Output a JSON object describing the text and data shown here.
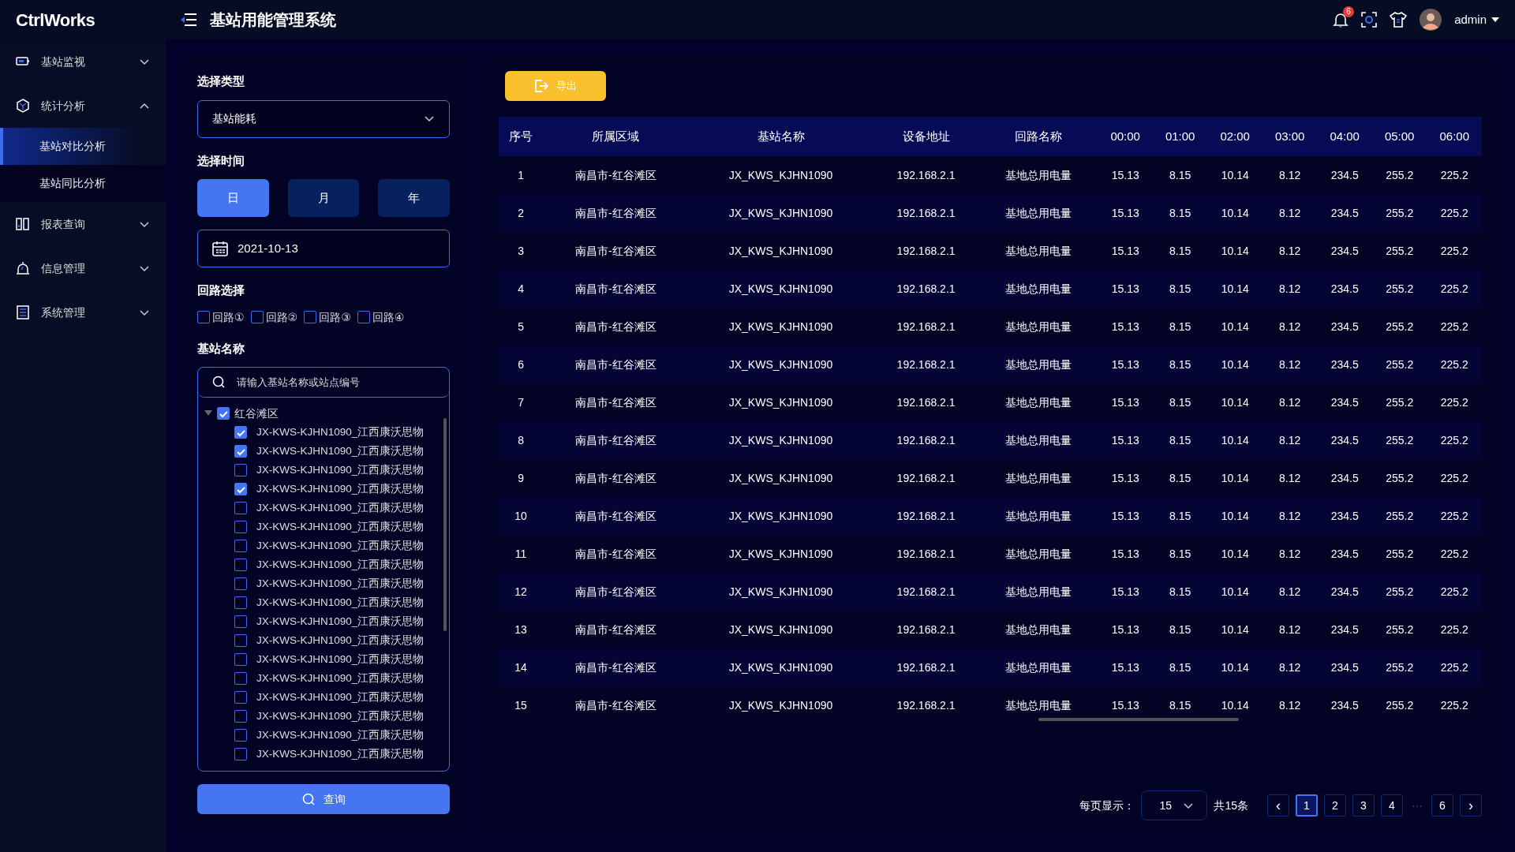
{
  "header": {
    "logo": "CtrlWorks",
    "title": "基站用能管理系统",
    "notification_count": "6",
    "user": "admin"
  },
  "sidebar": {
    "items": [
      {
        "label": "基站监视",
        "expanded": false
      },
      {
        "label": "统计分析",
        "expanded": true,
        "children": [
          {
            "label": "基站对比分析",
            "selected": true
          },
          {
            "label": "基站同比分析",
            "selected": false
          }
        ]
      },
      {
        "label": "报表查询",
        "expanded": false
      },
      {
        "label": "信息管理",
        "expanded": false
      },
      {
        "label": "系统管理",
        "expanded": false
      }
    ]
  },
  "filters": {
    "type_label": "选择类型",
    "type_value": "基站能耗",
    "time_label": "选择时间",
    "time_buttons": [
      {
        "label": "日",
        "selected": true
      },
      {
        "label": "月",
        "selected": false
      },
      {
        "label": "年",
        "selected": false
      }
    ],
    "date": "2021-10-13",
    "circuit_label": "回路选择",
    "circuits": [
      {
        "label": "回路①",
        "checked": false
      },
      {
        "label": "回路②",
        "checked": false
      },
      {
        "label": "回路③",
        "checked": false
      },
      {
        "label": "回路④",
        "checked": false
      }
    ],
    "station_label": "基站名称",
    "search": {
      "placeholder": "请输入基站名称或站点编号"
    },
    "tree": [
      {
        "label": "红谷滩区",
        "checked": true,
        "expanded": true,
        "children": [
          {
            "label": "JX-KWS-KJHN1090_江西康沃思物",
            "checked": true
          },
          {
            "label": "JX-KWS-KJHN1090_江西康沃思物",
            "checked": true
          },
          {
            "label": "JX-KWS-KJHN1090_江西康沃思物",
            "checked": false
          },
          {
            "label": "JX-KWS-KJHN1090_江西康沃思物",
            "checked": true
          },
          {
            "label": "JX-KWS-KJHN1090_江西康沃思物",
            "checked": false
          },
          {
            "label": "JX-KWS-KJHN1090_江西康沃思物",
            "checked": false
          },
          {
            "label": "JX-KWS-KJHN1090_江西康沃思物",
            "checked": false
          },
          {
            "label": "JX-KWS-KJHN1090_江西康沃思物",
            "checked": false
          },
          {
            "label": "JX-KWS-KJHN1090_江西康沃思物",
            "checked": false
          },
          {
            "label": "JX-KWS-KJHN1090_江西康沃思物",
            "checked": false
          },
          {
            "label": "JX-KWS-KJHN1090_江西康沃思物",
            "checked": false
          },
          {
            "label": "JX-KWS-KJHN1090_江西康沃思物",
            "checked": false
          },
          {
            "label": "JX-KWS-KJHN1090_江西康沃思物",
            "checked": false
          },
          {
            "label": "JX-KWS-KJHN1090_江西康沃思物",
            "checked": false
          },
          {
            "label": "JX-KWS-KJHN1090_江西康沃思物",
            "checked": false
          },
          {
            "label": "JX-KWS-KJHN1090_江西康沃思物",
            "checked": false
          },
          {
            "label": "JX-KWS-KJHN1090_江西康沃思物",
            "checked": false
          },
          {
            "label": "JX-KWS-KJHN1090_江西康沃思物",
            "checked": false
          }
        ]
      }
    ],
    "query_button": "查询"
  },
  "main": {
    "export_button": "导出",
    "table": {
      "columns": [
        "序号",
        "所属区域",
        "基站名称",
        "设备地址",
        "回路名称",
        "00:00",
        "01:00",
        "02:00",
        "03:00",
        "04:00",
        "05:00",
        "06:00"
      ],
      "rows": [
        [
          "1",
          "南昌市-红谷滩区",
          "JX_KWS_KJHN1090",
          "192.168.2.1",
          "基地总用电量",
          "15.13",
          "8.15",
          "10.14",
          "8.12",
          "234.5",
          "255.2",
          "225.2"
        ],
        [
          "2",
          "南昌市-红谷滩区",
          "JX_KWS_KJHN1090",
          "192.168.2.1",
          "基地总用电量",
          "15.13",
          "8.15",
          "10.14",
          "8.12",
          "234.5",
          "255.2",
          "225.2"
        ],
        [
          "3",
          "南昌市-红谷滩区",
          "JX_KWS_KJHN1090",
          "192.168.2.1",
          "基地总用电量",
          "15.13",
          "8.15",
          "10.14",
          "8.12",
          "234.5",
          "255.2",
          "225.2"
        ],
        [
          "4",
          "南昌市-红谷滩区",
          "JX_KWS_KJHN1090",
          "192.168.2.1",
          "基地总用电量",
          "15.13",
          "8.15",
          "10.14",
          "8.12",
          "234.5",
          "255.2",
          "225.2"
        ],
        [
          "5",
          "南昌市-红谷滩区",
          "JX_KWS_KJHN1090",
          "192.168.2.1",
          "基地总用电量",
          "15.13",
          "8.15",
          "10.14",
          "8.12",
          "234.5",
          "255.2",
          "225.2"
        ],
        [
          "6",
          "南昌市-红谷滩区",
          "JX_KWS_KJHN1090",
          "192.168.2.1",
          "基地总用电量",
          "15.13",
          "8.15",
          "10.14",
          "8.12",
          "234.5",
          "255.2",
          "225.2"
        ],
        [
          "7",
          "南昌市-红谷滩区",
          "JX_KWS_KJHN1090",
          "192.168.2.1",
          "基地总用电量",
          "15.13",
          "8.15",
          "10.14",
          "8.12",
          "234.5",
          "255.2",
          "225.2"
        ],
        [
          "8",
          "南昌市-红谷滩区",
          "JX_KWS_KJHN1090",
          "192.168.2.1",
          "基地总用电量",
          "15.13",
          "8.15",
          "10.14",
          "8.12",
          "234.5",
          "255.2",
          "225.2"
        ],
        [
          "9",
          "南昌市-红谷滩区",
          "JX_KWS_KJHN1090",
          "192.168.2.1",
          "基地总用电量",
          "15.13",
          "8.15",
          "10.14",
          "8.12",
          "234.5",
          "255.2",
          "225.2"
        ],
        [
          "10",
          "南昌市-红谷滩区",
          "JX_KWS_KJHN1090",
          "192.168.2.1",
          "基地总用电量",
          "15.13",
          "8.15",
          "10.14",
          "8.12",
          "234.5",
          "255.2",
          "225.2"
        ],
        [
          "11",
          "南昌市-红谷滩区",
          "JX_KWS_KJHN1090",
          "192.168.2.1",
          "基地总用电量",
          "15.13",
          "8.15",
          "10.14",
          "8.12",
          "234.5",
          "255.2",
          "225.2"
        ],
        [
          "12",
          "南昌市-红谷滩区",
          "JX_KWS_KJHN1090",
          "192.168.2.1",
          "基地总用电量",
          "15.13",
          "8.15",
          "10.14",
          "8.12",
          "234.5",
          "255.2",
          "225.2"
        ],
        [
          "13",
          "南昌市-红谷滩区",
          "JX_KWS_KJHN1090",
          "192.168.2.1",
          "基地总用电量",
          "15.13",
          "8.15",
          "10.14",
          "8.12",
          "234.5",
          "255.2",
          "225.2"
        ],
        [
          "14",
          "南昌市-红谷滩区",
          "JX_KWS_KJHN1090",
          "192.168.2.1",
          "基地总用电量",
          "15.13",
          "8.15",
          "10.14",
          "8.12",
          "234.5",
          "255.2",
          "225.2"
        ],
        [
          "15",
          "南昌市-红谷滩区",
          "JX_KWS_KJHN1090",
          "192.168.2.1",
          "基地总用电量",
          "15.13",
          "8.15",
          "10.14",
          "8.12",
          "234.5",
          "255.2",
          "225.2"
        ]
      ]
    },
    "pagination": {
      "per_page_label": "每页显示：",
      "per_page": "15",
      "total": "共15条",
      "pages": [
        {
          "kind": "prev",
          "label": "‹"
        },
        {
          "kind": "page",
          "label": "1",
          "selected": true
        },
        {
          "kind": "page",
          "label": "2",
          "selected": false
        },
        {
          "kind": "page",
          "label": "3",
          "selected": false
        },
        {
          "kind": "page",
          "label": "4",
          "selected": false
        },
        {
          "kind": "gap",
          "label": "···"
        },
        {
          "kind": "page",
          "label": "6",
          "selected": false
        },
        {
          "kind": "next",
          "label": "›"
        }
      ]
    }
  }
}
